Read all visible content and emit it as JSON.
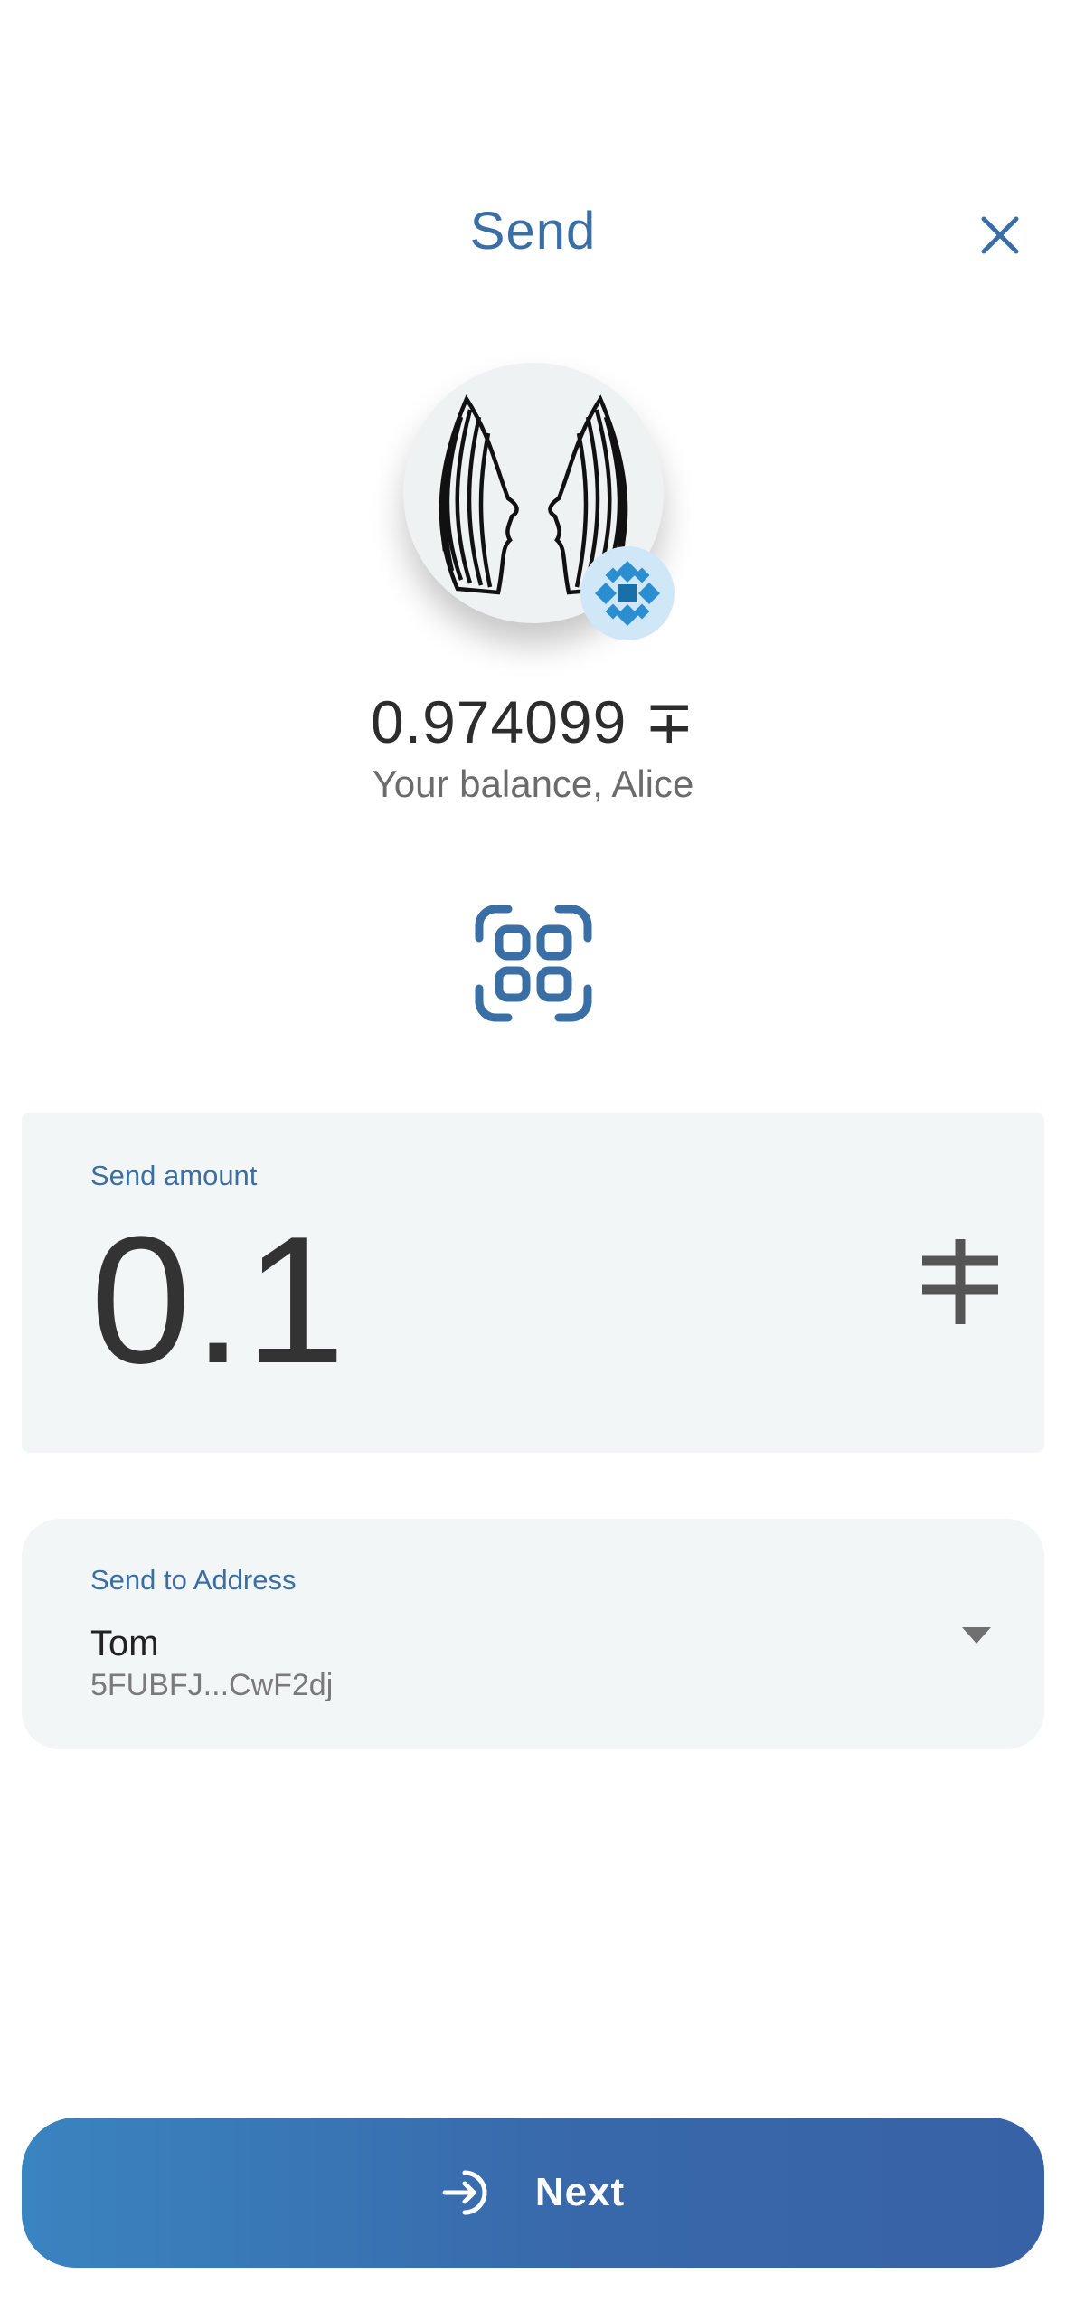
{
  "header": {
    "title": "Send",
    "close_icon": "close-icon"
  },
  "account": {
    "avatar_icon": "faces-avatar-icon",
    "badge_icon": "network-badge-icon",
    "balance": "0.974099 ∓",
    "caption": "Your balance, Alice"
  },
  "scan": {
    "icon": "scan-qr-icon"
  },
  "amount": {
    "label": "Send amount",
    "value": "0.1",
    "currency_icon": "currency-symbol-icon"
  },
  "recipient": {
    "label": "Send to Address",
    "name": "Tom",
    "address": "5FUBFJ...CwF2dj",
    "dropdown_icon": "chevron-down-icon"
  },
  "footer": {
    "next_label": "Next",
    "next_icon": "arrow-enter-icon"
  },
  "colors": {
    "accent": "#3a6fa6",
    "button_gradient_start": "#3a84c0",
    "button_gradient_end": "#3862a6",
    "card_bg": "#f3f6f7"
  }
}
